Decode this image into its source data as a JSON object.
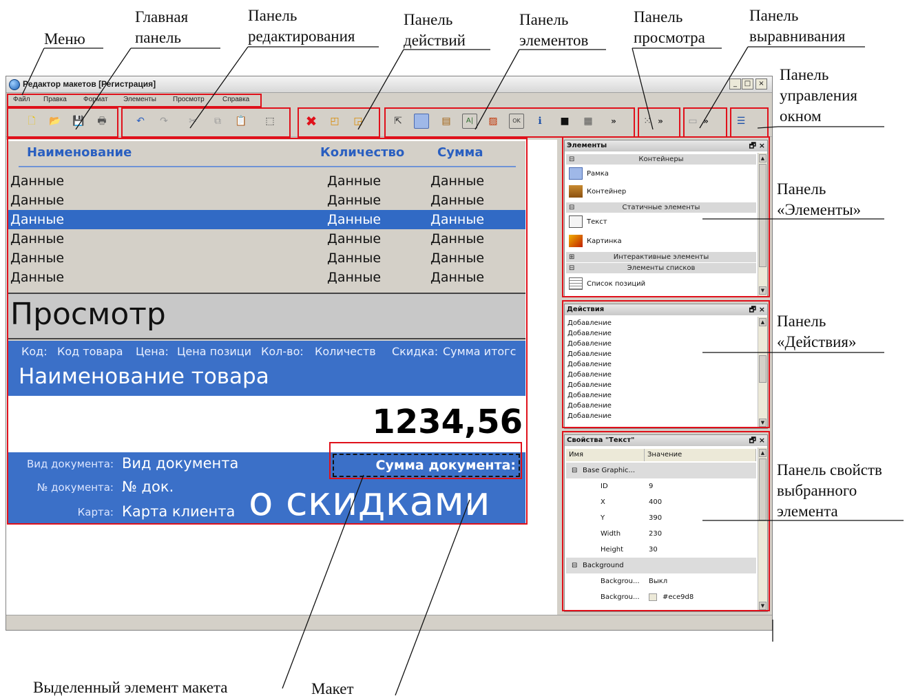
{
  "annotations": {
    "menu": "Меню",
    "main_panel": [
      "Главная",
      "панель"
    ],
    "edit_panel": [
      "Панель",
      "редактирования"
    ],
    "actions_panel": [
      "Панель",
      "действий"
    ],
    "elements_panel": [
      "Панель",
      "элементов"
    ],
    "view_panel": [
      "Панель",
      "просмотра"
    ],
    "align_panel": [
      "Панель",
      "выравнивания"
    ],
    "window_panel": [
      "Панель",
      "управления",
      "окном"
    ],
    "elements_dock": [
      "Панель",
      "«Элементы»"
    ],
    "actions_dock": [
      "Панель",
      "«Действия»"
    ],
    "props_dock": [
      "Панель свойств",
      "выбранного",
      "элемента"
    ],
    "selected_element": "Выделенный элемент макета",
    "layout": "Макет"
  },
  "window": {
    "title": "Редактор макетов [Регистрация]",
    "minimize": "_",
    "maximize": "□",
    "close": "×"
  },
  "menu": [
    "Файл",
    "Правка",
    "Формат",
    "Элементы",
    "Просмотр",
    "Справка"
  ],
  "toolbar": {
    "icons": [
      "new-file-icon",
      "open-icon",
      "save-icon",
      "print-icon",
      "undo-icon",
      "redo-icon",
      "cut-icon",
      "copy-icon",
      "paste-icon",
      "select-all-icon",
      "delete-icon",
      "bring-front-icon",
      "send-back-icon",
      "pointer-icon",
      "frame-icon",
      "container-icon",
      "text-icon",
      "picture-icon",
      "button-icon",
      "info-icon",
      "black-box-icon",
      "list-icon",
      "grid-icon",
      "align-icon",
      "window-icon"
    ],
    "more": "»"
  },
  "layout": {
    "headers": [
      "Наименование",
      "Количество",
      "Сумма"
    ],
    "rows": [
      [
        "Данные",
        "Данные",
        "Данные"
      ],
      [
        "Данные",
        "Данные",
        "Данные"
      ],
      [
        "Данные",
        "Данные",
        "Данные"
      ],
      [
        "Данные",
        "Данные",
        "Данные"
      ],
      [
        "Данные",
        "Данные",
        "Данные"
      ],
      [
        "Данные",
        "Данные",
        "Данные"
      ]
    ],
    "view_label": "Просмотр",
    "info": {
      "code_label": "Код:",
      "code_value": "Код товара",
      "price_label": "Цена:",
      "price_value": "Цена позици",
      "qty_label": "Кол-во:",
      "qty_value": "Количеств",
      "disc_label": "Скидка:",
      "disc_value": "Сумма итогс",
      "name": "Наименование товара"
    },
    "price": "1234,56",
    "doc": {
      "type_label": "Вид документа:",
      "type_value": "Вид документа",
      "num_label": "№ документа:",
      "num_value": "№ док.",
      "card_label": "Карта:",
      "card_value": "Карта клиента",
      "total_label": "Сумма документа:",
      "discount": "о скидками"
    }
  },
  "elements_panel": {
    "title": "Элементы",
    "buttons": "🗗 ×",
    "groups": {
      "containers": "Контейнеры",
      "static": "Статичные элементы",
      "interactive": "Интерактивные элементы",
      "lists": "Элементы списков"
    },
    "items": {
      "frame": "Рамка",
      "container": "Контейнер",
      "text": "Текст",
      "picture": "Картинка",
      "poslist": "Список позиций"
    },
    "minus": "⊟",
    "plus": "⊞"
  },
  "actions_panel": {
    "title": "Действия",
    "buttons": "🗗 ×",
    "items": [
      "Добавление",
      "Добавление",
      "Добавление",
      "Добавление",
      "Добавление",
      "Добавление",
      "Добавление",
      "Добавление",
      "Добавление",
      "Добавление"
    ]
  },
  "props_panel": {
    "title": "Свойства \"Текст\"",
    "buttons": "🗗 ×",
    "col_name": "Имя",
    "col_value": "Значение",
    "group1": "Base Graphic...",
    "props": [
      {
        "name": "ID",
        "value": "9"
      },
      {
        "name": "X",
        "value": "400"
      },
      {
        "name": "Y",
        "value": "390"
      },
      {
        "name": "Width",
        "value": "230"
      },
      {
        "name": "Height",
        "value": "30"
      }
    ],
    "group2": "Background",
    "bg_props": [
      {
        "name": "Backgrou...",
        "value": "Выкл"
      },
      {
        "name": "Backgrou...",
        "value": "#ece9d8"
      }
    ]
  },
  "colors": {
    "highlight": "#e0101a",
    "accent": "#3b70c8",
    "selection": "#316ac5",
    "header_text": "#2a5fc0",
    "swatch": "#ece9d8"
  }
}
